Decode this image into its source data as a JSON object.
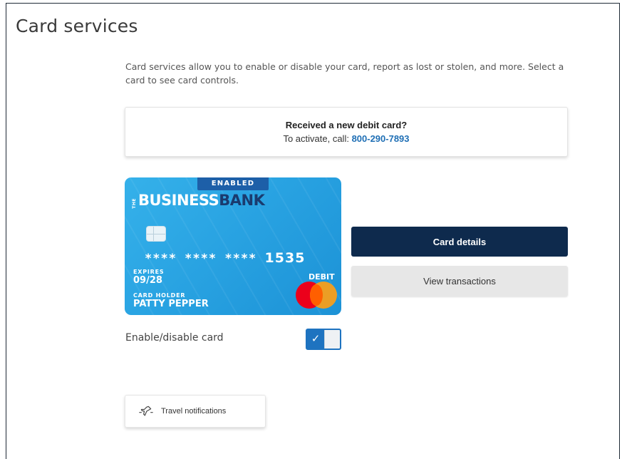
{
  "page": {
    "title": "Card services",
    "intro": "Card services allow you to enable or disable your card, report as lost or stolen, and more. Select a card to see card controls."
  },
  "notice": {
    "title": "Received a new debit card?",
    "prefix": "To activate, call: ",
    "phone": "800-290-7893"
  },
  "card": {
    "status_badge": "ENABLED",
    "brand_prefix": "THE",
    "brand_part1": "BUSINESS",
    "brand_part2": "BANK",
    "masked_number": "**** **** **** ",
    "last4": "1535",
    "expires_label": "EXPIRES",
    "expires_value": "09/28",
    "holder_label": "CARD HOLDER",
    "holder_name": "PATTY PEPPER",
    "type_label": "DEBIT",
    "network_icon": "mastercard-logo"
  },
  "actions": {
    "details_label": "Card details",
    "transactions_label": "View transactions"
  },
  "toggle": {
    "label": "Enable/disable card",
    "state": "on",
    "checkmark": "✓"
  },
  "travel": {
    "label": "Travel notifications",
    "icon": "airplane-icon"
  },
  "colors": {
    "primary_button": "#0e2a4d",
    "link": "#1f6fb5",
    "toggle": "#1e73c0",
    "card": "#29a3e2"
  }
}
